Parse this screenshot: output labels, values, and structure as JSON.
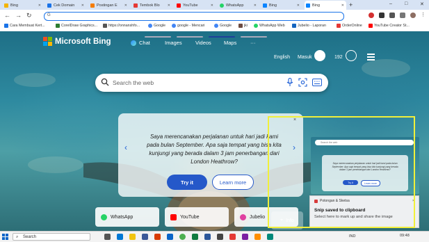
{
  "browser": {
    "tabs": [
      {
        "label": "Bing",
        "color": "#f4b400",
        "active": false
      },
      {
        "label": "Cek Domain",
        "color": "#1a73e8",
        "active": false
      },
      {
        "label": "Postingan E",
        "color": "#f57c00",
        "active": false
      },
      {
        "label": "Tembok Blo",
        "color": "#e53935",
        "active": false
      },
      {
        "label": "YouTube",
        "color": "#ff0000",
        "active": false
      },
      {
        "label": "WhatsApp",
        "color": "#25d366",
        "active": false
      },
      {
        "label": "Bing",
        "color": "#0a84ff",
        "active": false
      },
      {
        "label": "Bing",
        "color": "#0a84ff",
        "active": true
      }
    ],
    "new_tab_label": "+",
    "window_controls": {
      "minimize": "–",
      "maximize": "□",
      "close": "✕"
    },
    "nav": {
      "back": "←",
      "forward": "→",
      "reload": "↻"
    },
    "address": "",
    "bookmarks": [
      {
        "label": "Cara Membuat Kert...",
        "color": "#1a73e8"
      },
      {
        "label": "CorelDraw Graphics...",
        "color": "#2e7d32"
      },
      {
        "label": "https://onnanshfo...",
        "color": "#555555"
      },
      {
        "label": "Google",
        "color": "#4285f4"
      },
      {
        "label": "google - Mencari",
        "color": "#4285f4"
      },
      {
        "label": "Google",
        "color": "#4285f4"
      },
      {
        "label": "jki",
        "color": "#6d4c41"
      },
      {
        "label": "WhatsApp Web",
        "color": "#25d366"
      },
      {
        "label": "Jubelio - Laporan",
        "color": "#1565c0"
      },
      {
        "label": "OrderOnline",
        "color": "#e53935"
      },
      {
        "label": "YouTube Creator St...",
        "color": "#ff0000"
      }
    ]
  },
  "bing": {
    "brand": "Microsoft Bing",
    "nav": [
      {
        "label": "Chat"
      },
      {
        "label": "Images"
      },
      {
        "label": "Videos"
      },
      {
        "label": "Maps"
      },
      {
        "label": "···"
      }
    ],
    "language": "English",
    "signin": "Masuk",
    "points": "192",
    "search_placeholder": "Search the web",
    "carousel": {
      "text": "Saya merencanakan perjalanan untuk hari jadi kami pada bulan September. Apa saja tempat yang bisa kita kunjungi yang berada dalam 3 jam penerbangan dari London Heathrow?",
      "try_label": "Try it",
      "learn_label": "Learn more",
      "close": "×",
      "prev": "‹",
      "next": "›"
    },
    "quick_links": [
      {
        "label": "WhatsApp",
        "color": "#25d366"
      },
      {
        "label": "YouTube",
        "color": "#ff0000"
      },
      {
        "label": "Jubelio",
        "color": "#e040a0"
      }
    ],
    "info_label": "Info"
  },
  "snip": {
    "app_name": "Potongan & Sketsa",
    "title": "Snip saved to clipboard",
    "message": "Select here to mark up and share the image",
    "close": "×",
    "thumb_search": "Search the web",
    "thumb_text": "Saya merencanakan perjalanan untuk hari jadi kami pada bulan September. Apa saja tempat yang bisa kita kunjungi yang berada dalam 3 jam penerbangan dari London Heathrow?",
    "thumb_try": "Try it",
    "thumb_learn": "Learn more"
  },
  "taskbar": {
    "search_placeholder": "Search",
    "tray": "IND",
    "time": "09:48"
  }
}
